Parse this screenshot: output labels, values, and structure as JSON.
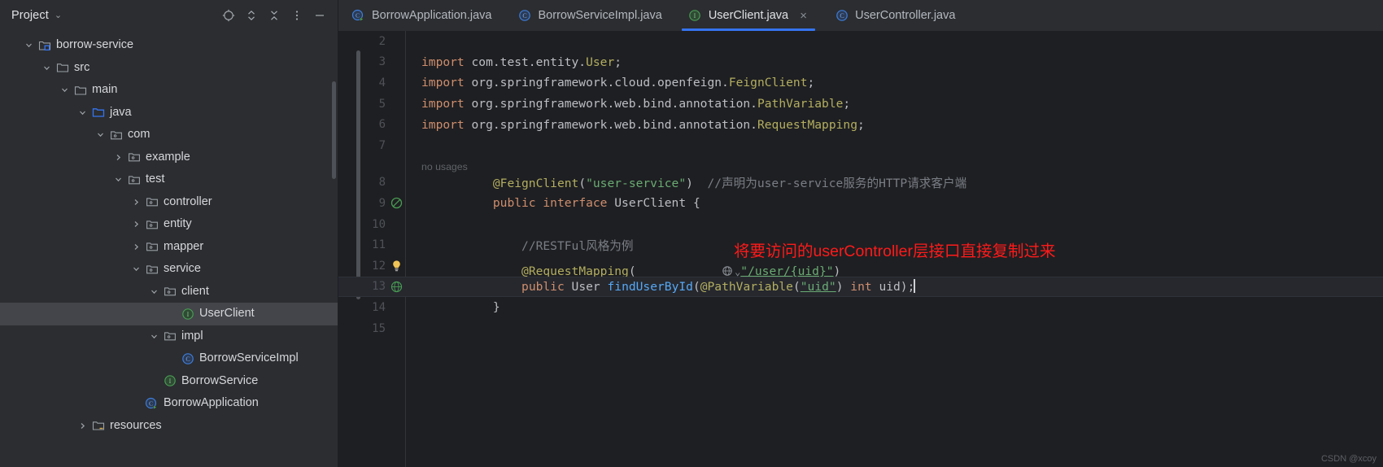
{
  "sidebar": {
    "title": "Project",
    "caret": "⌄",
    "tools": [
      {
        "name": "locate-icon",
        "label": "Select Opened File"
      },
      {
        "name": "expand-collapse-icon",
        "label": "Expand/Collapse"
      },
      {
        "name": "collapse-all-icon",
        "label": "Collapse All"
      },
      {
        "name": "more-options-icon",
        "label": "Options"
      },
      {
        "name": "minimize-icon",
        "label": "Hide"
      }
    ],
    "tree": [
      {
        "label": "borrow-service",
        "indent": 1,
        "arrow": "down",
        "icon": "module-folder-icon",
        "selected": false
      },
      {
        "label": "src",
        "indent": 2,
        "arrow": "down",
        "icon": "folder-icon",
        "selected": false
      },
      {
        "label": "main",
        "indent": 3,
        "arrow": "down",
        "icon": "folder-icon",
        "selected": false
      },
      {
        "label": "java",
        "indent": 4,
        "arrow": "down",
        "icon": "source-folder-icon",
        "selected": false
      },
      {
        "label": "com",
        "indent": 5,
        "arrow": "down",
        "icon": "package-icon",
        "selected": false
      },
      {
        "label": "example",
        "indent": 6,
        "arrow": "right",
        "icon": "package-icon",
        "selected": false
      },
      {
        "label": "test",
        "indent": 6,
        "arrow": "down",
        "icon": "package-icon",
        "selected": false
      },
      {
        "label": "controller",
        "indent": 7,
        "arrow": "right",
        "icon": "package-icon",
        "selected": false
      },
      {
        "label": "entity",
        "indent": 7,
        "arrow": "right",
        "icon": "package-icon",
        "selected": false
      },
      {
        "label": "mapper",
        "indent": 7,
        "arrow": "right",
        "icon": "package-icon",
        "selected": false
      },
      {
        "label": "service",
        "indent": 7,
        "arrow": "down",
        "icon": "package-icon",
        "selected": false
      },
      {
        "label": "client",
        "indent": 8,
        "arrow": "down",
        "icon": "package-icon",
        "selected": false
      },
      {
        "label": "UserClient",
        "indent": 9,
        "arrow": "none",
        "icon": "interface-icon",
        "selected": true
      },
      {
        "label": "impl",
        "indent": 8,
        "arrow": "down",
        "icon": "package-icon",
        "selected": false
      },
      {
        "label": "BorrowServiceImpl",
        "indent": 9,
        "arrow": "none",
        "icon": "class-icon",
        "selected": false
      },
      {
        "label": "BorrowService",
        "indent": 8,
        "arrow": "none",
        "icon": "interface-icon",
        "selected": false
      },
      {
        "label": "BorrowApplication",
        "indent": 7,
        "arrow": "none",
        "icon": "runnable-class-icon",
        "selected": false
      },
      {
        "label": "resources",
        "indent": 4,
        "arrow": "right",
        "icon": "resource-folder-icon",
        "selected": false
      }
    ]
  },
  "tabs": [
    {
      "label": "BorrowApplication.java",
      "icon": "runnable-class-icon",
      "active": false,
      "closable": false
    },
    {
      "label": "BorrowServiceImpl.java",
      "icon": "class-icon",
      "active": false,
      "closable": false
    },
    {
      "label": "UserClient.java",
      "icon": "interface-icon",
      "active": true,
      "closable": true,
      "close_glyph": "×"
    },
    {
      "label": "UserController.java",
      "icon": "class-icon",
      "active": false,
      "closable": false
    }
  ],
  "editor": {
    "inlay_hint": "no usages",
    "lines": [
      {
        "num": "2",
        "text": "",
        "gutter": "",
        "current": false
      },
      {
        "num": "3",
        "text": "import com.test.entity.User;",
        "gutter": "",
        "current": false
      },
      {
        "num": "4",
        "text": "import org.springframework.cloud.openfeign.FeignClient;",
        "gutter": "",
        "current": false
      },
      {
        "num": "5",
        "text": "import org.springframework.web.bind.annotation.PathVariable;",
        "gutter": "",
        "current": false
      },
      {
        "num": "6",
        "text": "import org.springframework.web.bind.annotation.RequestMapping;",
        "gutter": "",
        "current": false
      },
      {
        "num": "7",
        "text": "",
        "gutter": "",
        "current": false
      },
      {
        "num": "8",
        "text": "@FeignClient(\"user-service\")  //声明为user-service服务的HTTP请求客户端",
        "gutter": "",
        "current": false
      },
      {
        "num": "9",
        "text": "public interface UserClient {",
        "gutter": "implemented-icon",
        "current": false
      },
      {
        "num": "10",
        "text": "",
        "gutter": "",
        "current": false
      },
      {
        "num": "11",
        "text": "    //RESTFul风格为例",
        "gutter": "",
        "current": false
      },
      {
        "num": "12",
        "text": "    @RequestMapping(\"/user/{uid}\")",
        "gutter": "intention-bulb-icon",
        "current": false
      },
      {
        "num": "13",
        "text": "    public User findUserById(@PathVariable(\"uid\") int uid);",
        "gutter": "web-endpoint-icon",
        "current": true
      },
      {
        "num": "14",
        "text": "}",
        "gutter": "",
        "current": false
      },
      {
        "num": "15",
        "text": "",
        "gutter": "",
        "current": false
      }
    ],
    "code_tokens": {
      "l3": [
        {
          "t": "import ",
          "c": "kw"
        },
        {
          "t": "com.test.entity.",
          "c": "pln"
        },
        {
          "t": "User",
          "c": "ann"
        },
        {
          "t": ";",
          "c": "pln"
        }
      ],
      "l4": [
        {
          "t": "import ",
          "c": "kw"
        },
        {
          "t": "org.springframework.cloud.openfeign.",
          "c": "pln"
        },
        {
          "t": "FeignClient",
          "c": "ann"
        },
        {
          "t": ";",
          "c": "pln"
        }
      ],
      "l5": [
        {
          "t": "import ",
          "c": "kw"
        },
        {
          "t": "org.springframework.web.bind.annotation.",
          "c": "pln"
        },
        {
          "t": "PathVariable",
          "c": "ann"
        },
        {
          "t": ";",
          "c": "pln"
        }
      ],
      "l6": [
        {
          "t": "import ",
          "c": "kw"
        },
        {
          "t": "org.springframework.web.bind.annotation.",
          "c": "pln"
        },
        {
          "t": "RequestMapping",
          "c": "ann"
        },
        {
          "t": ";",
          "c": "pln"
        }
      ]
    },
    "line8": {
      "annotation": "@FeignClient",
      "paren_open": "(",
      "string": "\"user-service\"",
      "paren_close": ")",
      "comment": "//声明为user-service服务的HTTP请求客户端"
    },
    "line9": {
      "kw1": "public",
      "kw2": "interface",
      "name": "UserClient",
      "brace": "{"
    },
    "line11": {
      "comment": "//RESTFul风格为例"
    },
    "line12": {
      "annotation": "@RequestMapping",
      "paren_open": "(",
      "chevron": "⌄",
      "path": "\"/user/{uid}\"",
      "paren_close": ")"
    },
    "line13": {
      "kw": "public",
      "type": "User",
      "method": "findUserById",
      "paren_open": "(",
      "param_ann": "@PathVariable",
      "param_str": "\"uid\"",
      "param_type": "int",
      "param_name": "uid",
      "tail": ");"
    },
    "line14": {
      "brace": "}"
    }
  },
  "annotation_note": "将要访问的userController层接口直接复制过来",
  "watermark": "CSDN @xcoy",
  "colors": {
    "accent": "#3574f0",
    "note_red": "#ff1a1a",
    "interface_green": "#499c54",
    "class_blue": "#3e7ddb",
    "keyword_orange": "#cf8e6d",
    "string_green": "#6aab73",
    "annotation_yellow": "#b3ae60"
  }
}
